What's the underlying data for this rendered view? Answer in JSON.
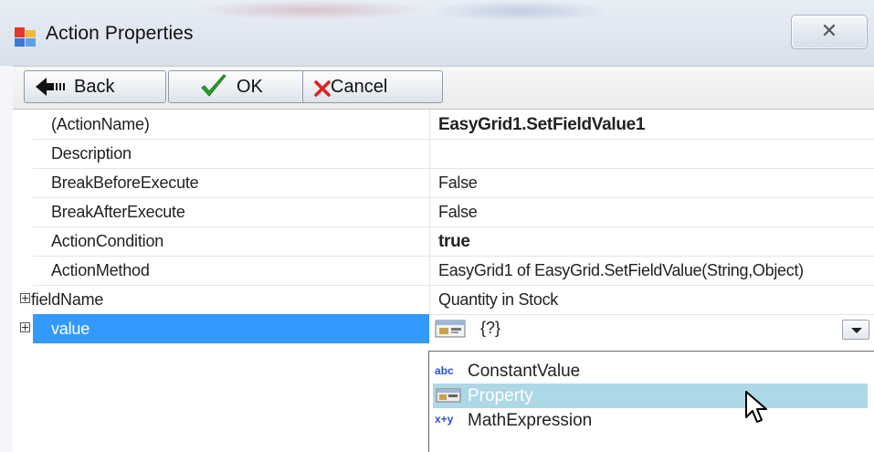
{
  "window": {
    "title": "Action Properties",
    "close_glyph": "✕"
  },
  "toolbar": {
    "back_label": "Back",
    "ok_label": "OK",
    "cancel_label": "Cancel"
  },
  "properties": [
    {
      "name": "(ActionName)",
      "value": "EasyGrid1.SetFieldValue1",
      "bold": true
    },
    {
      "name": "Description",
      "value": ""
    },
    {
      "name": "BreakBeforeExecute",
      "value": "False"
    },
    {
      "name": "BreakAfterExecute",
      "value": "False"
    },
    {
      "name": "ActionCondition",
      "value": "true",
      "bold": true
    },
    {
      "name": "ActionMethod",
      "value": "EasyGrid1 of EasyGrid.SetFieldValue(String,Object)"
    },
    {
      "name": "fieldName",
      "value": "Quantity in Stock",
      "expandable": true
    },
    {
      "name": "value",
      "value": "{?}",
      "expandable": true,
      "selected": true
    }
  ],
  "dropdown": {
    "options": [
      {
        "label": "ConstantValue",
        "icon": "abc"
      },
      {
        "label": "Property",
        "icon": "property-icon",
        "highlighted": true
      },
      {
        "label": "MathExpression",
        "icon": "x+y"
      }
    ]
  },
  "colors": {
    "selection": "#3399ff",
    "highlight": "#add8e6"
  }
}
